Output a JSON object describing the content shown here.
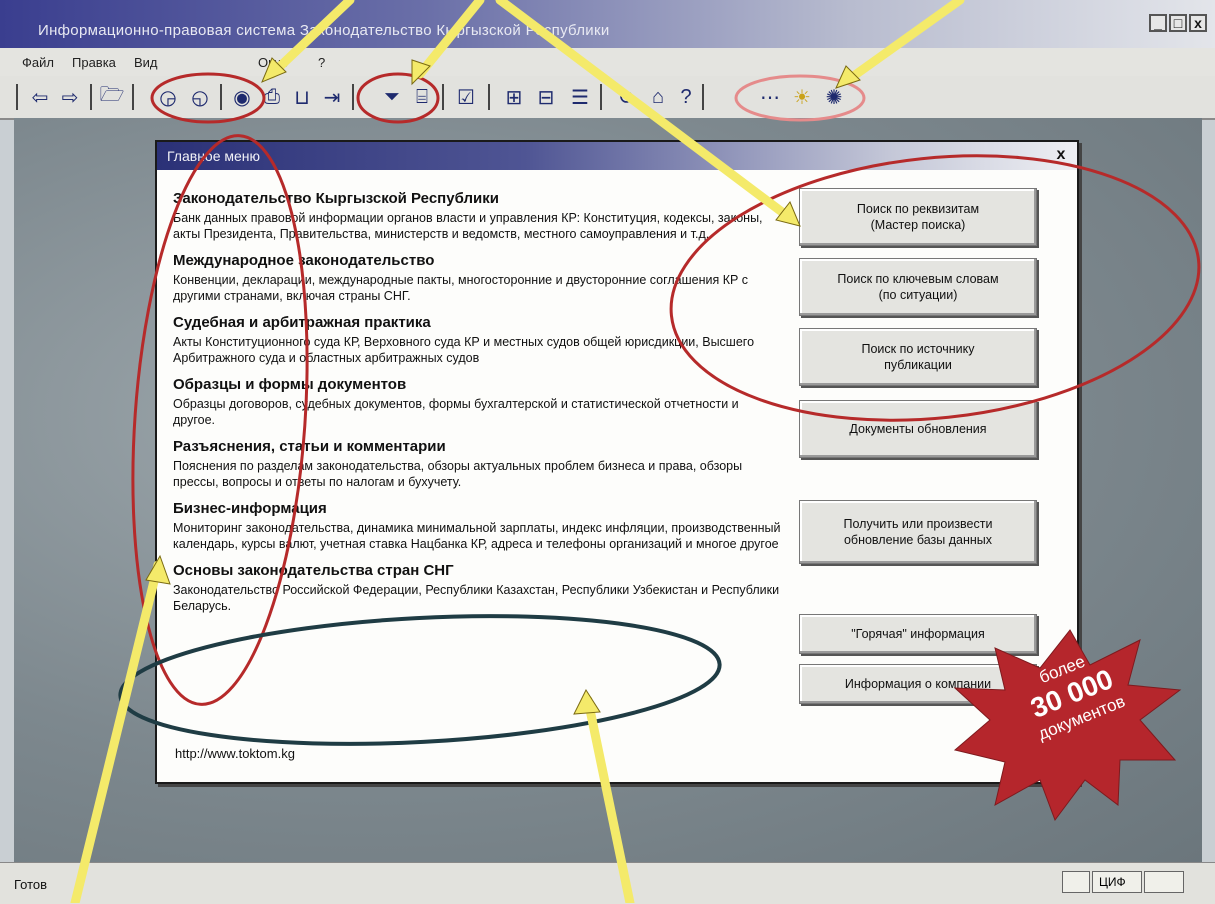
{
  "window": {
    "title": "Информационно-правовая система Законодательство Кыргызской Республики",
    "controls": [
      "_",
      "□",
      "x"
    ]
  },
  "menu": [
    "Файл",
    "Правка",
    "Вид",
    "Окно",
    "?"
  ],
  "toolbar": {
    "icons": [
      "back-icon",
      "forward-icon",
      "open-folder-icon",
      "search-icon",
      "search-folders-icon",
      "web-icon",
      "print-icon",
      "book-icon",
      "next-icon",
      "filter-icon",
      "bookmark-icon",
      "checkbox-icon",
      "tree-icon",
      "tree-alt-icon",
      "list-icon",
      "refresh-icon",
      "home-icon",
      "help-icon",
      "dots-icon",
      "sun-icon",
      "swirl-icon"
    ]
  },
  "dialog": {
    "title": "Главное меню",
    "close": "x",
    "sections": [
      {
        "heading": "Законодательство Кыргызской Республики",
        "text": "Банк данных правовой информации органов власти и управления КР: Конституция, кодексы, законы, акты Президента, Правительства, министерств и ведомств, местного самоуправления и т.д."
      },
      {
        "heading": "Международное законодательство",
        "text": "Конвенции, декларации, международные пакты, многосторонние и двусторонние соглашения КР с другими странами, включая страны СНГ."
      },
      {
        "heading": "Судебная и арбитражная практика",
        "text": "Акты Конституционного суда КР, Верховного суда КР и местных судов общей юрисдикции, Высшего Арбитражного суда и областных арбитражных судов"
      },
      {
        "heading": "Образцы и формы документов",
        "text": "Образцы договоров, судебных документов, формы бухгалтерской и статистической отчетности и другое."
      },
      {
        "heading": "Разъяснения, статьи и комментарии",
        "text": "Пояснения по разделам законодательства, обзоры актуальных проблем бизнеса и права, обзоры прессы, вопросы и ответы по налогам и бухучету."
      },
      {
        "heading": "Бизнес-информация",
        "text": "Мониторинг законодательства, динамика минимальной зарплаты, индекс инфляции, производственный календарь, курсы валют, учетная ставка Нацбанка КР, адреса и телефоны организаций и многое другое"
      },
      {
        "heading": "Основы законодательства стран СНГ",
        "text": "Законодательство Российской Федерации, Республики Казахстан, Республики Узбекистан и Республики Беларусь."
      }
    ],
    "url": "http://www.toktom.kg",
    "buttons": [
      "Поиск по реквизитам\n(Мастер поиска)",
      "Поиск по ключевым словам\n(по ситуации)",
      "Поиск по источнику\nпубликации",
      "Документы обновления",
      "Получить или произвести\nобновление базы данных",
      "\"Горячая\" информация",
      "Информация о компании"
    ]
  },
  "badge": {
    "line1": "более",
    "line2": "30 000",
    "line3": "документов",
    "color": "#b5262c"
  },
  "status": {
    "ready": "Готов",
    "indicator": "ЦИФ"
  }
}
